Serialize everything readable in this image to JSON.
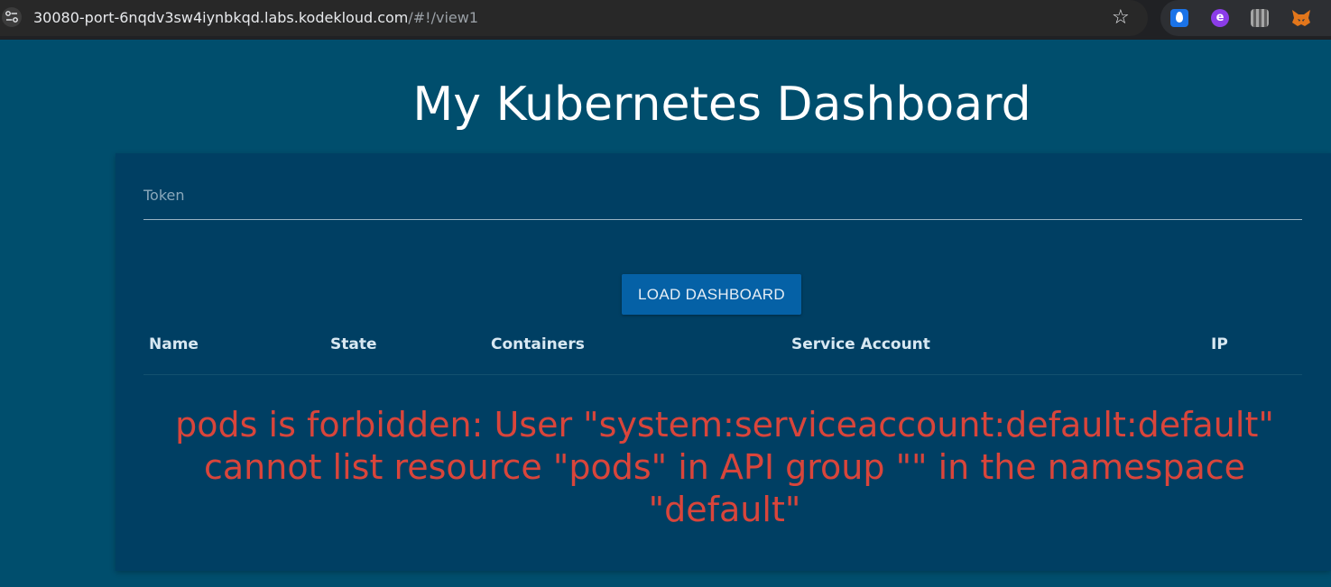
{
  "browser": {
    "url_host": "30080-port-6nqdv3sw4iynbkqd.labs.kodekloud.com",
    "url_path": "/#!/view1",
    "icons": [
      "site-info-icon",
      "star-icon",
      "water-drop-extension-icon",
      "e-extension-icon",
      "qr-extension-icon",
      "fox-extension-icon"
    ]
  },
  "page": {
    "title": "My Kubernetes Dashboard"
  },
  "form": {
    "token_label": "Token",
    "token_value": "",
    "load_button": "LOAD DASHBOARD"
  },
  "table": {
    "columns": [
      "Name",
      "State",
      "Containers",
      "Service Account",
      "IP"
    ]
  },
  "error": {
    "message": "pods is forbidden: User \"system:serviceaccount:default:default\" cannot list resource \"pods\" in API group \"\" in the namespace \"default\""
  },
  "colors": {
    "page_background": "#004e6d",
    "card_background": "#003f63",
    "button": "#0561a6",
    "error_text": "#d9453b"
  }
}
